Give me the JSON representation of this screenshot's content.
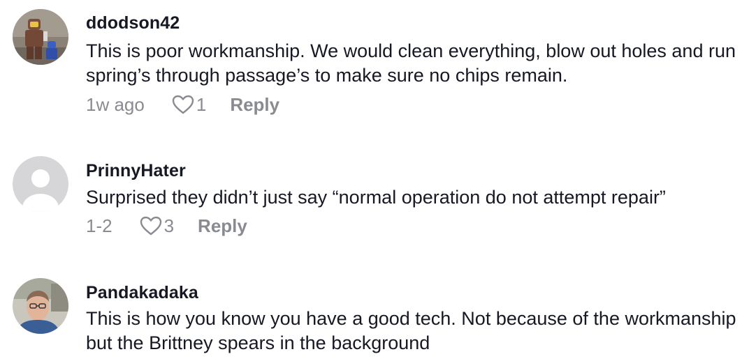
{
  "comments": [
    {
      "username": "ddodson42",
      "text": "This is poor workmanship. We would clean everything, blow out holes and run spring’s through passage’s to make sure no chips remain.",
      "time": "1w ago",
      "likes": "1",
      "reply_label": "Reply",
      "avatar": "lego-astronaut-photo"
    },
    {
      "username": "PrinnyHater",
      "text": "Surprised they didn’t just say “normal operation do not attempt repair”",
      "time": "1-2",
      "likes": "3",
      "reply_label": "Reply",
      "avatar": "default-person-icon"
    },
    {
      "username": "Pandakadaka",
      "text": "This is how you know you have a good tech. Not because of the workmanship but the Brittney spears in the background",
      "time": "",
      "likes": "",
      "reply_label": "",
      "avatar": "man-with-glasses-photo"
    }
  ],
  "colors": {
    "text": "#161823",
    "meta": "#8a8b91",
    "default_avatar_bg": "#d6d6d8"
  }
}
